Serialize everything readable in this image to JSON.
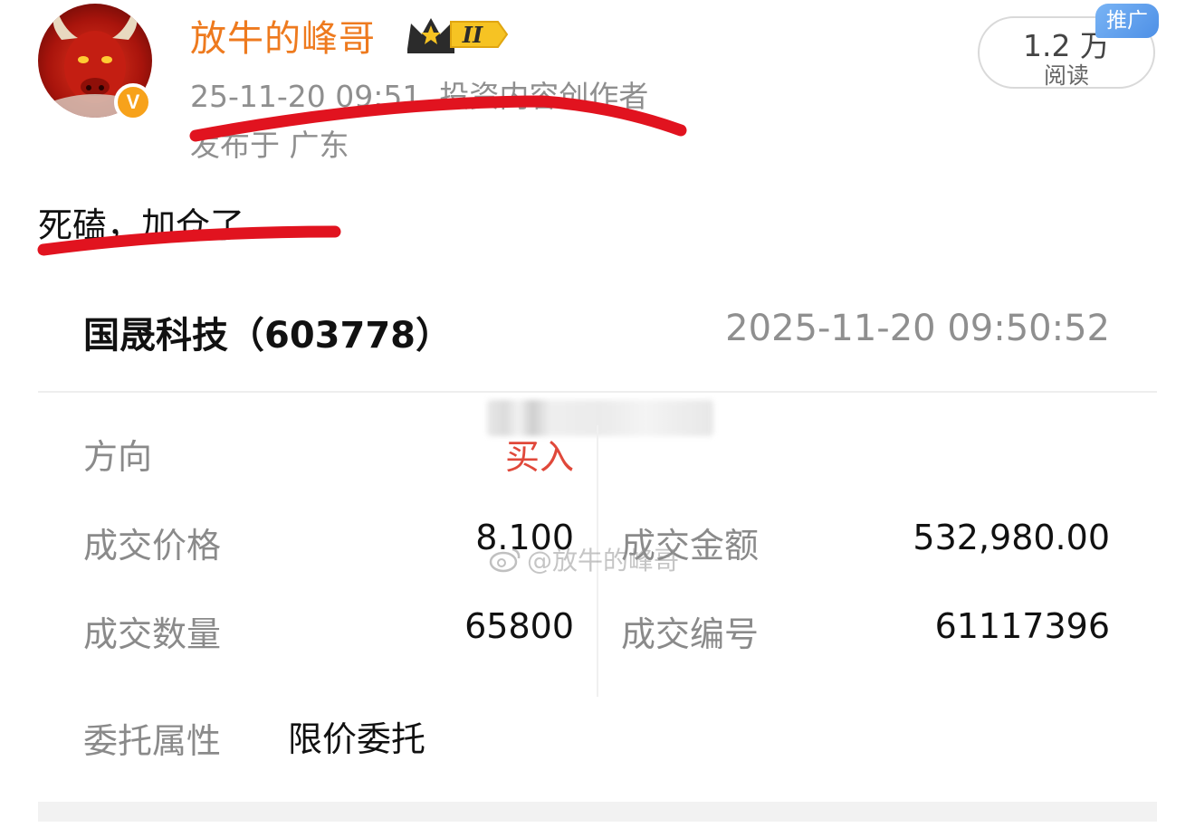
{
  "header": {
    "username": "放牛的峰哥",
    "level_badge": "II",
    "timestamp": "25-11-20 09:51",
    "author_tag": "投资内容创作者",
    "location": "发布于 广东",
    "read_count": "1.2 万",
    "read_label": "阅读",
    "promo_tag": "推广",
    "verified_mark": "V"
  },
  "post": {
    "text": "死磕，加仓了"
  },
  "trade": {
    "stock": "国晟科技（603778）",
    "time": "2025-11-20 09:50:52",
    "direction_label": "方向",
    "direction_value": "买入",
    "price_label": "成交价格",
    "price_value": "8.100",
    "amount_label": "成交金额",
    "amount_value": "532,980.00",
    "quantity_label": "成交数量",
    "quantity_value": "65800",
    "order_no_label": "成交编号",
    "order_no_value": "61117396",
    "order_type_label": "委托属性",
    "order_type_value": "限价委托"
  },
  "watermark": "@放牛的峰哥",
  "colors": {
    "username": "#ee7a1e",
    "buy": "#e0483a",
    "annotation": "#e1131f",
    "promo": "#4e90e6",
    "verified": "#f7a21b"
  }
}
